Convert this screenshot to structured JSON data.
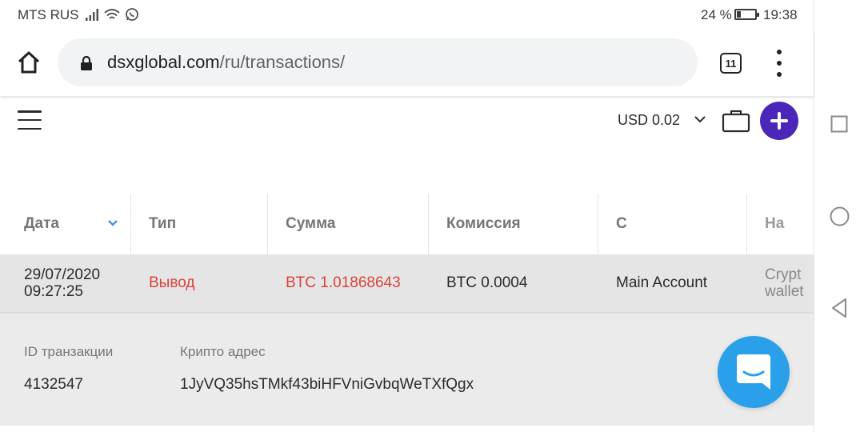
{
  "status_bar": {
    "carrier": "MTS RUS",
    "battery_percent_text": "24 %",
    "battery_level": 0.24,
    "time": "19:38",
    "icons": [
      "signal-icon",
      "wifi-icon",
      "whatsapp-icon",
      "battery-icon"
    ]
  },
  "browser": {
    "url_domain": "dsxglobal.com",
    "url_path": "/ru/transactions/",
    "tab_count": "11",
    "icons": [
      "home-icon",
      "lock-icon",
      "more-vert-icon"
    ]
  },
  "header": {
    "balance": "USD 0.02",
    "accent_color": "#4a27b8",
    "icons": [
      "menu-icon",
      "chevron-down-icon",
      "briefcase-icon",
      "plus-icon"
    ]
  },
  "table": {
    "columns": [
      "Дата",
      "Тип",
      "Сумма",
      "Комиссия",
      "С",
      "На"
    ],
    "rows": [
      {
        "date": "29/07/2020",
        "time": "09:27:25",
        "type": "Вывод",
        "amount": "BTC 1.01868643",
        "fee": "BTC 0.0004",
        "from": "Main Account",
        "to_line1": "Crypt",
        "to_line2": "wallet"
      }
    ],
    "detail": {
      "id_label": "ID транзакции",
      "id_value": "4132547",
      "address_label": "Крипто адрес",
      "address_value": "1JyVQ35hsTMkf43biHFVniGvbqWeTXfQgx"
    },
    "negative_color": "#d9443c"
  },
  "chat": {
    "color": "#2aa0ea",
    "icon": "chat-icon"
  },
  "nav_bar": {
    "icons": [
      "recents-icon",
      "home-circle-icon",
      "back-icon"
    ]
  }
}
